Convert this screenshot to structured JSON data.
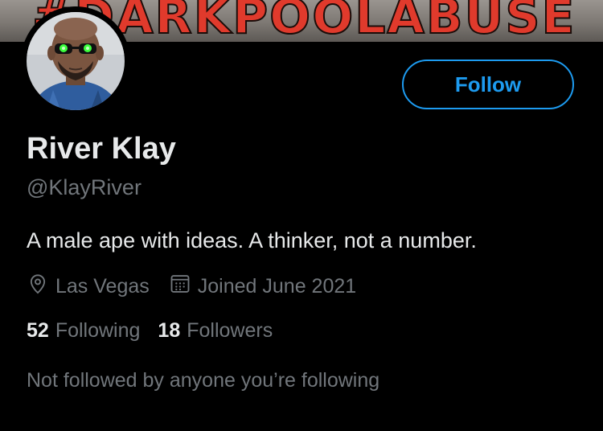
{
  "banner": {
    "text": "#DARKPOOLABUSE"
  },
  "profile": {
    "display_name": "River Klay",
    "handle": "@KlayRiver",
    "bio": "A male ape with ideas. A thinker, not a number.",
    "location": "Las Vegas",
    "joined": "Joined June 2021",
    "following_count": "52",
    "following_label": "Following",
    "followers_count": "18",
    "followers_label": "Followers",
    "followed_by": "Not followed by anyone you’re following"
  },
  "actions": {
    "follow_label": "Follow"
  },
  "icons": {
    "location": "location-pin-icon",
    "joined": "calendar-icon"
  },
  "colors": {
    "accent": "#1d9bf0",
    "background": "#000000",
    "text_primary": "#e7e9ea",
    "text_secondary": "#71767b",
    "banner_text": "#e03a2c"
  }
}
